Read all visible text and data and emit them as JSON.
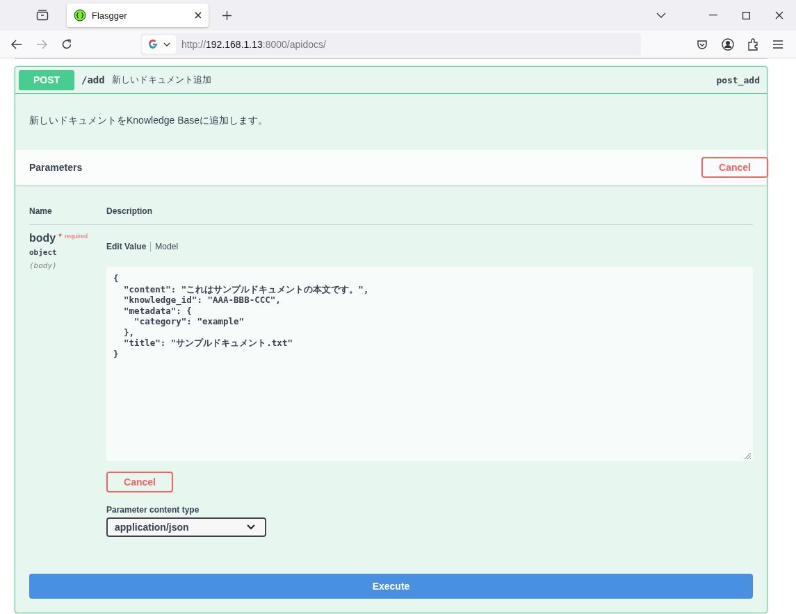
{
  "browser": {
    "tabs": [
      {
        "title": "Flasgger",
        "selected": true
      }
    ],
    "url": {
      "scheme": "http://",
      "host": "192.168.1.13",
      "rest": ":8000/apidocs/"
    }
  },
  "operation": {
    "method": "POST",
    "path": "/add",
    "summary": "新しいドキュメント追加",
    "operation_id": "post_add",
    "description": "新しいドキュメントをKnowledge Baseに追加します。",
    "parameters_title": "Parameters",
    "cancel_top": "Cancel",
    "columns": [
      "Name",
      "Description"
    ],
    "param": {
      "name": "body",
      "required_mark": "*",
      "required_label": "required",
      "type": "object",
      "location": "(body)"
    },
    "value_tabs": [
      {
        "label": "Edit Value",
        "selected": true
      },
      {
        "label": "Model",
        "selected": false
      }
    ],
    "body_value": "{\n  \"content\": \"これはサンプルドキュメントの本文です。\",\n  \"knowledge_id\": \"AAA-BBB-CCC\",\n  \"metadata\": {\n    \"category\": \"example\"\n  },\n  \"title\": \"サンプルドキュメント.txt\"\n}",
    "cancel_bottom": "Cancel",
    "content_type_label": "Parameter content type",
    "content_type": "application/json",
    "execute": "Execute"
  }
}
